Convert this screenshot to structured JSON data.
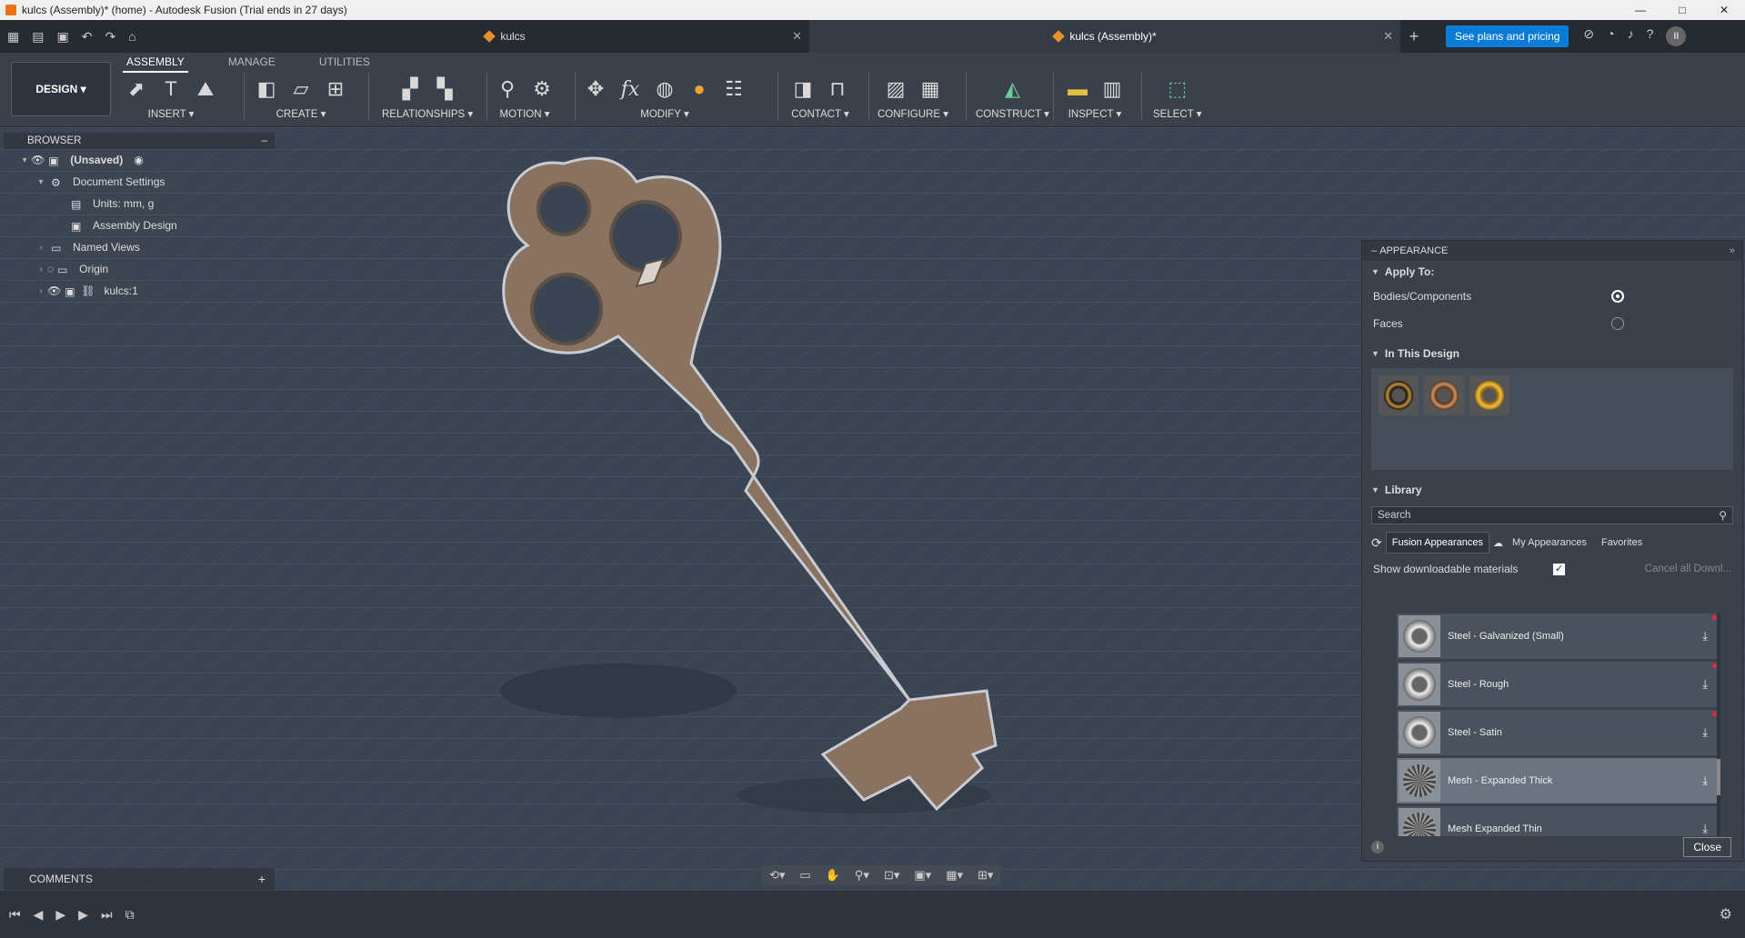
{
  "window": {
    "title": "kulcs (Assembly)* (home) - Autodesk Fusion (Trial ends in 27 days)",
    "controls": [
      "—",
      "□",
      "✕"
    ]
  },
  "tabs": {
    "tab1": "kulcs",
    "tab2": "kulcs (Assembly)*",
    "plans_button": "See plans and pricing",
    "user_initials": "II"
  },
  "toolbar": {
    "workspace": "DESIGN",
    "subtabs": [
      "ASSEMBLY",
      "MANAGE",
      "UTILITIES"
    ],
    "groups": {
      "insert": "INSERT",
      "create": "CREATE",
      "relationships": "RELATIONSHIPS",
      "motion": "MOTION",
      "modify": "MODIFY",
      "contact": "CONTACT",
      "configure": "CONFIGURE",
      "construct": "CONSTRUCT",
      "inspect": "INSPECT",
      "select": "SELECT"
    }
  },
  "browser": {
    "title": "BROWSER",
    "items": [
      {
        "label": "(Unsaved)"
      },
      {
        "label": "Document Settings"
      },
      {
        "label": "Units: mm, g"
      },
      {
        "label": "Assembly Design"
      },
      {
        "label": "Named Views"
      },
      {
        "label": "Origin"
      },
      {
        "label": "kulcs:1"
      }
    ]
  },
  "comments": {
    "title": "COMMENTS"
  },
  "appearance": {
    "title": "APPEARANCE",
    "apply_to": "Apply To:",
    "opt_bodies": "Bodies/Components",
    "opt_faces": "Faces",
    "in_this_design": "In This Design",
    "library": "Library",
    "search_placeholder": "Search",
    "lib_tabs": [
      "Fusion Appearances",
      "My Appearances",
      "Favorites"
    ],
    "show_downloadable": "Show downloadable materials",
    "cancel_downloads": "Cancel all Downl...",
    "items": [
      {
        "name": "Steel - Galvanized (Small)"
      },
      {
        "name": "Steel - Rough"
      },
      {
        "name": "Steel - Satin"
      },
      {
        "name": "Mesh - Expanded Thick"
      },
      {
        "name": "Mesh Expanded Thin"
      }
    ],
    "close": "Close"
  },
  "colors": {
    "accent": "#0a7bd6",
    "key_body": "#8a7260",
    "viewport": "#3b4452"
  }
}
